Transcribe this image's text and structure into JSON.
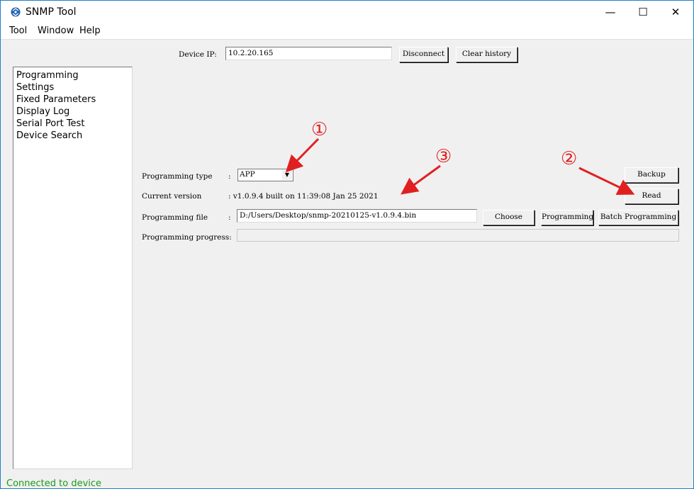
{
  "window": {
    "title": "SNMP Tool",
    "controls": {
      "minimize": "—",
      "maximize": "☐",
      "close": "✕"
    }
  },
  "menu": [
    "Tool",
    "Window",
    "Help"
  ],
  "connection": {
    "device_ip_label": "Device IP:",
    "device_ip_value": "10.2.20.165",
    "disconnect_label": "Disconnect",
    "clear_history_label": "Clear history"
  },
  "sidebar": {
    "items": [
      "Programming",
      "Settings",
      "Fixed Parameters",
      "Display Log",
      "Serial Port Test",
      "Device Search"
    ]
  },
  "programming": {
    "type_label": "Programming type",
    "type_sep": ":",
    "type_value": "APP",
    "version_label": "Current version",
    "version_value": ": v1.0.9.4 built on 11:39:08 Jan 25 2021",
    "file_label": "Programming file",
    "file_sep": ":",
    "file_value": "D:/Users/Desktop/snmp-20210125-v1.0.9.4.bin",
    "progress_label": "Programming progress:",
    "progress": 0,
    "buttons": {
      "backup": "Backup",
      "read": "Read",
      "choose": "Choose",
      "programming": "Programming",
      "batch": "Batch Programming"
    }
  },
  "annotations": {
    "one": "①",
    "two": "②",
    "three": "③",
    "color": "#e02020"
  },
  "status": {
    "text": "Connected to device",
    "color": "#1b9a1b"
  }
}
